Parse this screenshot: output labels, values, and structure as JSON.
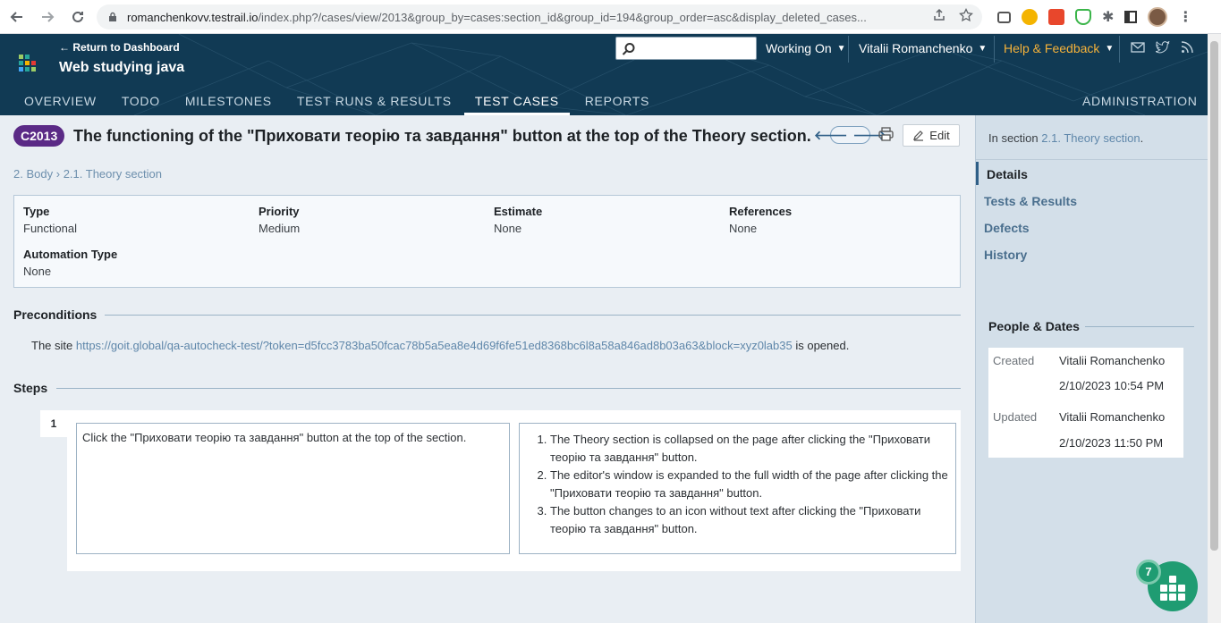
{
  "browser": {
    "url_main": "romanchenkovv.testrail.io",
    "url_rest": "/index.php?/cases/view/2013&group_by=cases:section_id&group_id=194&group_order=asc&display_deleted_cases..."
  },
  "header": {
    "return_label": "← Return to Dashboard",
    "project_name": "Web studying java",
    "search_placeholder": "",
    "working_on": "Working On",
    "user_name": "Vitalii Romanchenko",
    "help": "Help & Feedback",
    "tabs": [
      "OVERVIEW",
      "TODO",
      "MILESTONES",
      "TEST RUNS & RESULTS",
      "TEST CASES",
      "REPORTS"
    ],
    "active_tab": "TEST CASES",
    "admin": "ADMINISTRATION"
  },
  "case": {
    "id": "C2013",
    "title": "The functioning of the \"Приховати теорію та завдання\" button at the top of the Theory section.",
    "edit_label": "Edit",
    "breadcrumb": {
      "part1": "2. Body",
      "sep": "›",
      "part2": "2.1. Theory section"
    },
    "fields": {
      "type_label": "Type",
      "type_value": "Functional",
      "priority_label": "Priority",
      "priority_value": "Medium",
      "estimate_label": "Estimate",
      "estimate_value": "None",
      "references_label": "References",
      "references_value": "None",
      "automation_label": "Automation Type",
      "automation_value": "None"
    },
    "preconditions": {
      "title": "Preconditions",
      "prefix": "The site ",
      "link": "https://goit.global/qa-autocheck-test/?token=d5fcc3783ba50fcac78b5a5ea8e4d69f6fe51ed8368bc6l8a58a846ad8b03a63&block=xyz0lab35",
      "suffix": " is opened."
    },
    "steps": {
      "title": "Steps",
      "number": "1",
      "content": "Click the \"Приховати теорію та завдання\" button at the top of the section.",
      "expected": [
        "The Theory section is collapsed on the page after clicking the \"Приховати теорію та завдання\" button.",
        "The editor's window is expanded to the full width of the page after clicking the \"Приховати теорію та завдання\" button.",
        "The button changes to an icon without text after clicking the \"Приховати теорію та завдання\" button."
      ]
    }
  },
  "sidebar": {
    "in_section_prefix": "In section ",
    "in_section_link": "2.1. Theory section",
    "in_section_suffix": ".",
    "items": [
      "Details",
      "Tests & Results",
      "Defects",
      "History"
    ],
    "people_title": "People & Dates",
    "created_label": "Created",
    "created_by": "Vitalii Romanchenko",
    "created_at": "2/10/2023 10:54 PM",
    "updated_label": "Updated",
    "updated_by": "Vitalii Romanchenko",
    "updated_at": "2/10/2023 11:50 PM"
  },
  "widget": {
    "badge": "7"
  },
  "colors": {
    "header_bg": "#113a54",
    "badge": "#5b2a86",
    "accent_link": "#5f87aa",
    "help": "#f5b23a",
    "fab": "#1f9c72"
  }
}
